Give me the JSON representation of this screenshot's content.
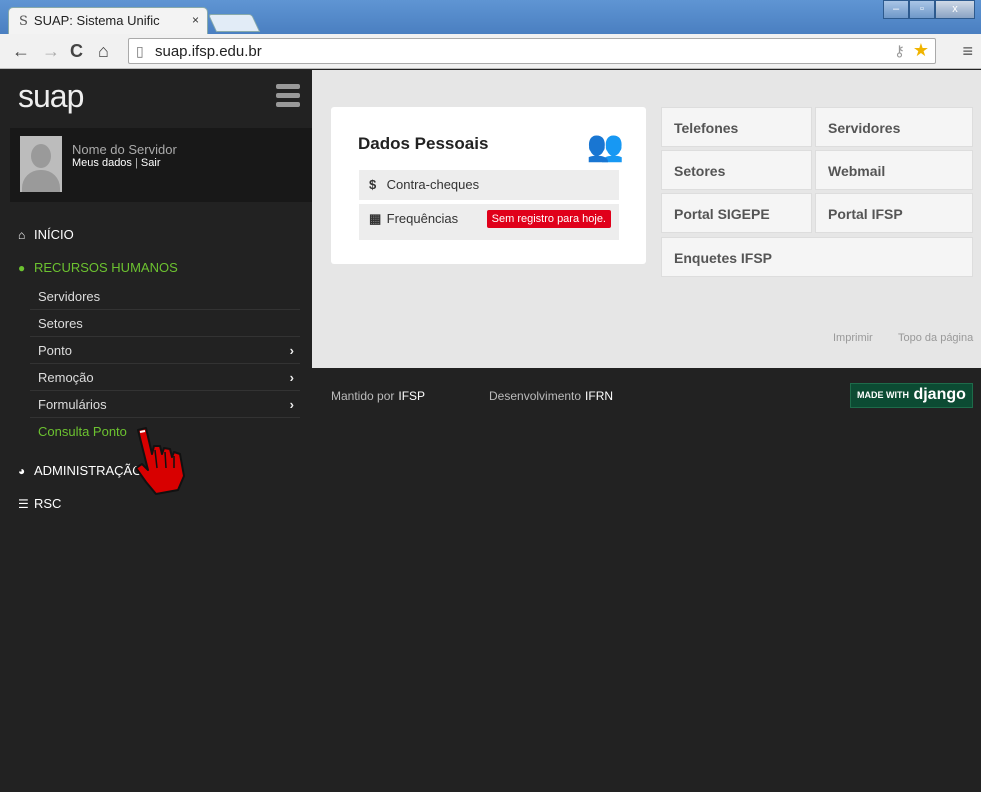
{
  "browser": {
    "tab_title": "SUAP: Sistema Unific",
    "tab_favicon": "S",
    "tab_close": "×",
    "url": "suap.ifsp.edu.br"
  },
  "sidebar": {
    "logo": "suap",
    "user": {
      "name": "Nome do Servidor",
      "meus_dados": "Meus dados",
      "separator": "|",
      "sair": "Sair"
    },
    "menu": [
      {
        "label": "INÍCIO",
        "icon": "home-icon"
      },
      {
        "label": "RECURSOS HUMANOS",
        "icon": "user-icon",
        "active": true
      },
      {
        "label": "ADMINISTRAÇÃO",
        "icon": "pie-chart-icon"
      },
      {
        "label": "RSC",
        "icon": "bank-icon"
      }
    ],
    "submenu": [
      {
        "label": "Servidores"
      },
      {
        "label": "Setores"
      },
      {
        "label": "Ponto",
        "chevron": "›"
      },
      {
        "label": "Remoção",
        "chevron": "›"
      },
      {
        "label": "Formulários",
        "chevron": "›"
      },
      {
        "label": "Consulta Ponto"
      }
    ]
  },
  "card": {
    "title": "Dados Pessoais",
    "rows": [
      {
        "icon": "$",
        "label": "Contra-cheques"
      },
      {
        "icon": "▦",
        "label": "Frequências",
        "badge": "Sem registro para hoje."
      }
    ]
  },
  "shortcuts": [
    "Telefones",
    "Servidores",
    "Setores",
    "Webmail",
    "Portal SIGEPE",
    "Portal IFSP",
    "Enquetes IFSP"
  ],
  "content_footer": {
    "imprimir": "Imprimir",
    "topo": "Topo da página"
  },
  "footer": {
    "mantido_label": "Mantido por",
    "mantido_value": "IFSP",
    "dev_label": "Desenvolvimento",
    "dev_value": "IFRN",
    "django_small": "MADE WITH",
    "django_big": "django"
  },
  "colors": {
    "accent_green": "#6cc230",
    "badge_red": "#e0001a",
    "sidebar_bg": "#222222"
  }
}
